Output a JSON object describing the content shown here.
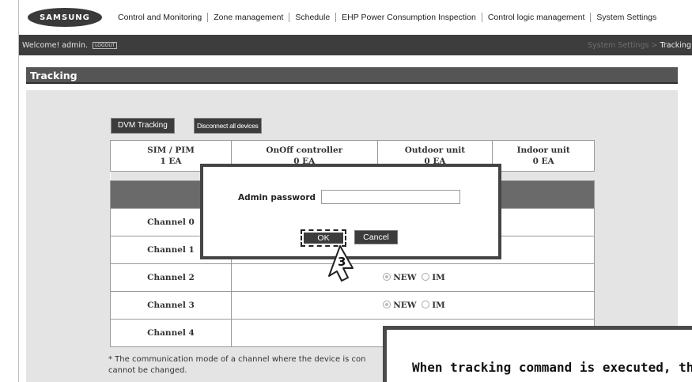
{
  "logo": "SAMSUNG",
  "menu": [
    "Control and Monitoring",
    "Zone management",
    "Schedule",
    "EHP Power Consumption Inspection",
    "Control logic management",
    "System Settings"
  ],
  "header": {
    "welcome": "Welcome! admin.",
    "logout": "LOGOUT",
    "breadcrumb_parent": "System Settings",
    "breadcrumb_sep": ">",
    "breadcrumb_current": "Tracking"
  },
  "page_title": "Tracking",
  "buttons": {
    "dvm_tracking": "DVM Tracking",
    "disconnect": "Disconnect all devices"
  },
  "summary": [
    {
      "label": "SIM / PIM",
      "count": "1 EA"
    },
    {
      "label": "OnOff controller",
      "count": "0 EA"
    },
    {
      "label": "Outdoor unit",
      "count": "0 EA"
    },
    {
      "label": "Indoor unit",
      "count": "0 EA"
    }
  ],
  "channels": [
    {
      "label": "Channel 0",
      "new": "",
      "im": ""
    },
    {
      "label": "Channel 1",
      "new": "",
      "im": ""
    },
    {
      "label": "Channel 2",
      "new": "NEW",
      "im": "IM"
    },
    {
      "label": "Channel 3",
      "new": "NEW",
      "im": "IM"
    },
    {
      "label": "Channel 4",
      "new": "",
      "im": ""
    }
  ],
  "note": "* The communication mode of a channel where the device is con cannot be changed.",
  "dialog": {
    "label": "Admin password",
    "value": "",
    "ok": "OK",
    "cancel": "Cancel"
  },
  "callout_number": "3",
  "tooltip": "When tracking command is executed, the"
}
